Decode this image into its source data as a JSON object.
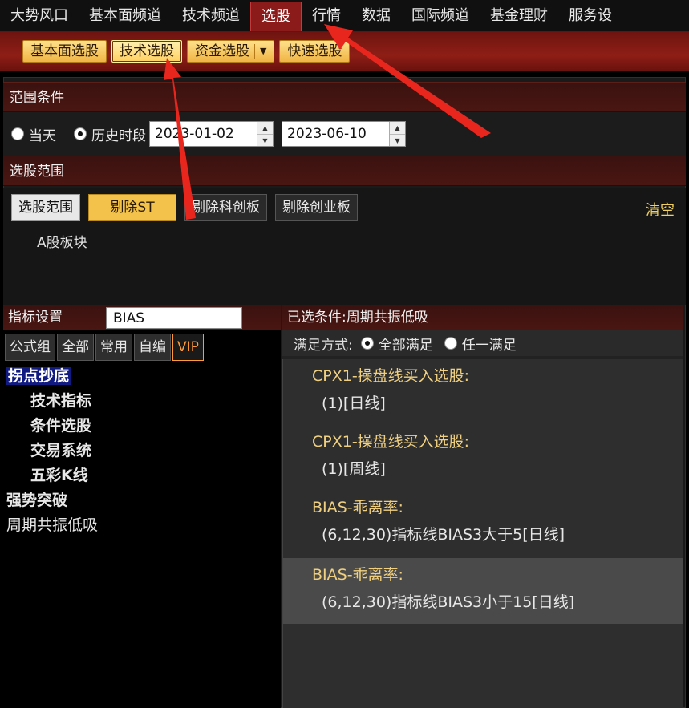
{
  "topnav": {
    "items": [
      "大势风口",
      "基本面频道",
      "技术频道",
      "选股",
      "行情",
      "数据",
      "国际频道",
      "基金理财",
      "服务设"
    ],
    "active_index": 3
  },
  "subbar": {
    "buttons": [
      "基本面选股",
      "技术选股",
      "资金选股",
      "快速选股"
    ],
    "active_index": 1,
    "dropdown_icon": "triangle-down-icon"
  },
  "range": {
    "header": "范围条件",
    "today_label": "当天",
    "history_label": "历史时段",
    "selected": "history",
    "start_date": "2023-01-02",
    "end_date": "2023-06-10"
  },
  "scope": {
    "header": "选股范围",
    "buttons": [
      "选股范围",
      "剔除ST",
      "剔除科创板",
      "剔除创业板"
    ],
    "clear_label": "清空",
    "board_label": "A股板块"
  },
  "indicator": {
    "header": "指标设置",
    "search_value": "BIAS",
    "tabs": [
      "公式组",
      "全部",
      "常用",
      "自编",
      "VIP"
    ],
    "tree": [
      {
        "label": "拐点抄底",
        "level": 0,
        "selected": true
      },
      {
        "label": "技术指标",
        "level": 1
      },
      {
        "label": "条件选股",
        "level": 1
      },
      {
        "label": "交易系统",
        "level": 1
      },
      {
        "label": "五彩K线",
        "level": 1
      },
      {
        "label": "强势突破",
        "level": 0
      },
      {
        "label": "周期共振低吸",
        "level": 0
      }
    ]
  },
  "selected": {
    "header": "已选条件:周期共振低吸",
    "mode_label": "满足方式:",
    "all_label": "全部满足",
    "any_label": "任一满足",
    "mode": "all",
    "conditions": [
      {
        "title": "CPX1-操盘线买入选股:",
        "detail": "(1)[日线]"
      },
      {
        "title": "CPX1-操盘线买入选股:",
        "detail": "(1)[周线]"
      },
      {
        "title": "BIAS-乖离率:",
        "detail": "(6,12,30)指标线BIAS3大于5[日线]"
      },
      {
        "title": "BIAS-乖离率:",
        "detail": "(6,12,30)指标线BIAS3小于15[日线]",
        "highlighted": true
      }
    ]
  },
  "colors": {
    "annotation_arrow": "#e8261e",
    "accent_gold": "#f2c24a",
    "header_red": "#4a1612"
  }
}
